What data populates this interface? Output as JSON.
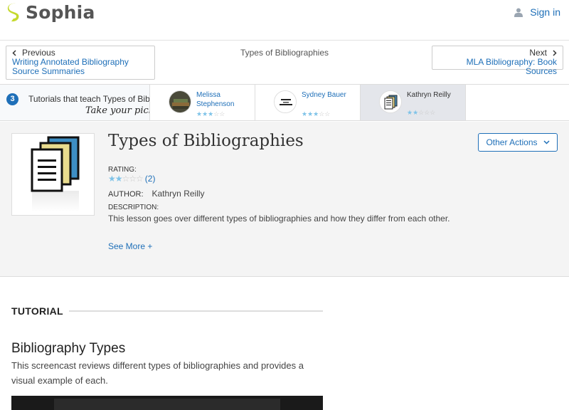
{
  "header": {
    "brand": "Sophia",
    "signin_label": "Sign in"
  },
  "nav": {
    "prev_dir": "Previous",
    "prev_link": "Writing Annotated Bibliography Source Summaries",
    "title": "Types of Bibliographies",
    "next_dir": "Next",
    "next_link": "MLA Bibliography: Book Sources"
  },
  "tutorials": {
    "count": "3",
    "intro": "Tutorials that teach Types of Bibliographies",
    "pick": "Take your pick:",
    "cards": [
      {
        "name": "Melissa Stephenson",
        "stars": 3
      },
      {
        "name": "Sydney Bauer",
        "stars": 3
      },
      {
        "name": "Kathryn Reilly",
        "stars": 2
      }
    ]
  },
  "summary": {
    "title": "Types of Bibliographies",
    "other_actions": "Other Actions",
    "rating_label": "RATING:",
    "rating_value": 2,
    "rating_count": "(2)",
    "author_label": "AUTHOR:",
    "author_name": "Kathryn Reilly",
    "description_label": "DESCRIPTION:",
    "description": "This lesson goes over different types of bibliographies and how they differ from each other.",
    "see_more": "See More +"
  },
  "tutorial_section": {
    "label": "TUTORIAL",
    "lesson_title": "Bibliography Types",
    "lesson_desc": "This screencast reviews different types of bibliographies and provides a visual example of each."
  },
  "colors": {
    "accent": "#1e6fb8",
    "logo_green": "#c5d92d",
    "star_on": "#7fc3e8"
  }
}
